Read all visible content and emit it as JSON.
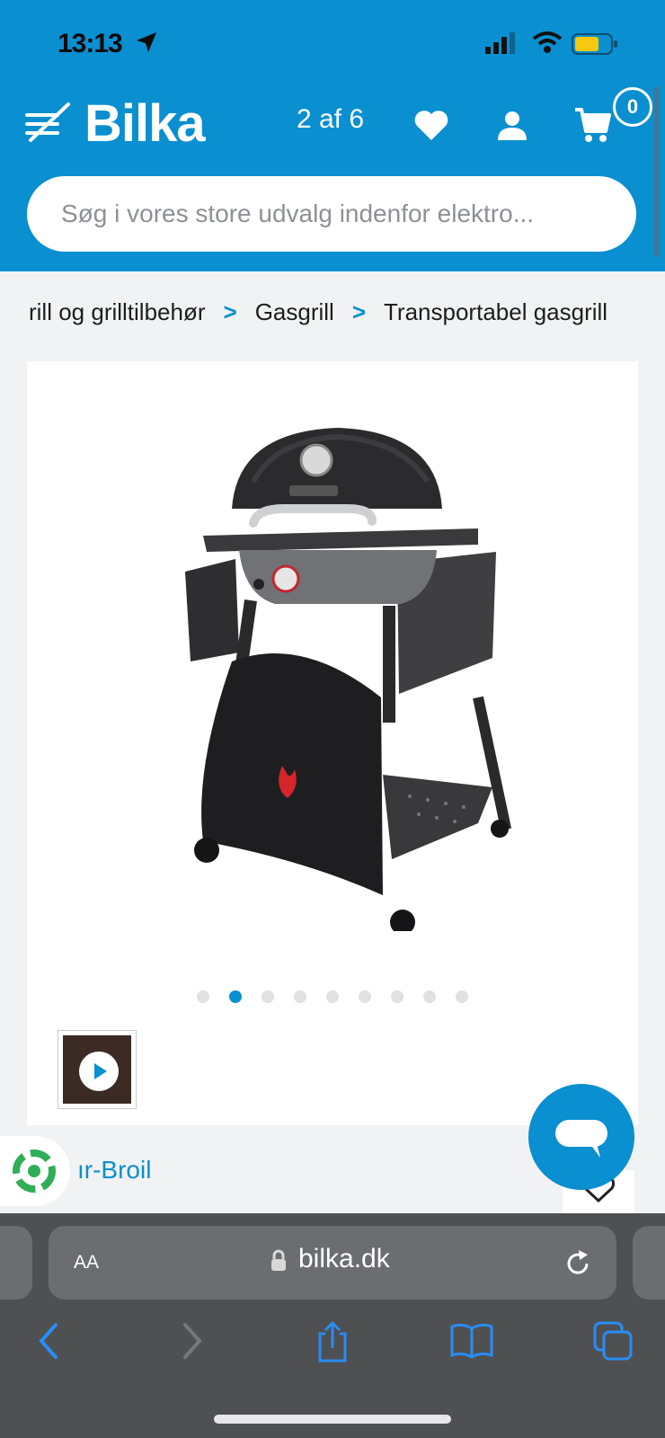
{
  "status_bar": {
    "time": "13:13"
  },
  "header": {
    "logo": "Bilka",
    "page_counter": "2 af 6",
    "cart_count": "0",
    "search_placeholder": "Søg i vores store udvalg indenfor elektro..."
  },
  "breadcrumb": [
    "rill og grilltilbehør",
    "Gasgrill",
    "Transportabel gasgrill"
  ],
  "product": {
    "image_name": "charbroil-gas-grill",
    "gallery_dots": 9,
    "active_dot": 1,
    "brand": "ır-Broil"
  },
  "browser": {
    "aa_label": "AA",
    "url": "bilka.dk"
  },
  "colors": {
    "brand_blue": "#0a8fd0",
    "browser_bar": "#4f5052"
  }
}
